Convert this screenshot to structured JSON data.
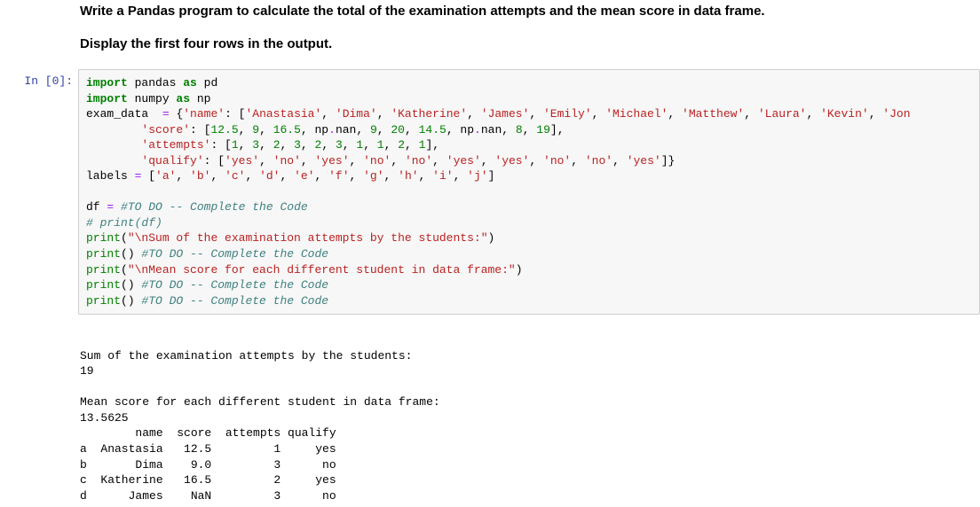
{
  "headings": {
    "h1": "Write a Pandas program to calculate the total of the examination attempts and the mean score in data frame.",
    "h2": "Display the first four rows in the output."
  },
  "prompt": "In [0]:",
  "code": {
    "l1a": "import",
    "l1b": " pandas ",
    "l1c": "as",
    "l1d": " pd",
    "l2a": "import",
    "l2b": " numpy ",
    "l2c": "as",
    "l2d": " np",
    "l3a": "exam_data  ",
    "l3b": "=",
    "l3c": " {",
    "l3d": "'name'",
    "l3e": ": [",
    "l3f": "'Anastasia'",
    "l3g": ", ",
    "l3h": "'Dima'",
    "l3i": ", ",
    "l3j": "'Katherine'",
    "l3k": ", ",
    "l3l": "'James'",
    "l3m": ", ",
    "l3n": "'Emily'",
    "l3o": ", ",
    "l3p": "'Michael'",
    "l3q": ", ",
    "l3r": "'Matthew'",
    "l3s": ", ",
    "l3t": "'Laura'",
    "l3u": ", ",
    "l3v": "'Kevin'",
    "l3w": ", ",
    "l3x": "'Jon",
    "l4a": "        ",
    "l4b": "'score'",
    "l4c": ": [",
    "l4d": "12.5",
    "l4e": ", ",
    "l4f": "9",
    "l4g": ", ",
    "l4h": "16.5",
    "l4i": ", np",
    "l4j": ".",
    "l4k": "nan, ",
    "l4l": "9",
    "l4m": ", ",
    "l4n": "20",
    "l4o": ", ",
    "l4p": "14.5",
    "l4q": ", np",
    "l4r": ".",
    "l4s": "nan, ",
    "l4t": "8",
    "l4u": ", ",
    "l4v": "19",
    "l4w": "],",
    "l5a": "        ",
    "l5b": "'attempts'",
    "l5c": ": [",
    "l5d": "1",
    "l5e": ", ",
    "l5f": "3",
    "l5g": ", ",
    "l5h": "2",
    "l5i": ", ",
    "l5j": "3",
    "l5k": ", ",
    "l5l": "2",
    "l5m": ", ",
    "l5n": "3",
    "l5o": ", ",
    "l5p": "1",
    "l5q": ", ",
    "l5r": "1",
    "l5s": ", ",
    "l5t": "2",
    "l5u": ", ",
    "l5v": "1",
    "l5w": "],",
    "l6a": "        ",
    "l6b": "'qualify'",
    "l6c": ": [",
    "l6d": "'yes'",
    "l6e": ", ",
    "l6f": "'no'",
    "l6g": ", ",
    "l6h": "'yes'",
    "l6i": ", ",
    "l6j": "'no'",
    "l6k": ", ",
    "l6l": "'no'",
    "l6m": ", ",
    "l6n": "'yes'",
    "l6o": ", ",
    "l6p": "'yes'",
    "l6q": ", ",
    "l6r": "'no'",
    "l6s": ", ",
    "l6t": "'no'",
    "l6u": ", ",
    "l6v": "'yes'",
    "l6w": "]}",
    "l7a": "labels ",
    "l7b": "=",
    "l7c": " [",
    "l7d": "'a'",
    "l7e": ", ",
    "l7f": "'b'",
    "l7g": ", ",
    "l7h": "'c'",
    "l7i": ", ",
    "l7j": "'d'",
    "l7k": ", ",
    "l7l": "'e'",
    "l7m": ", ",
    "l7n": "'f'",
    "l7o": ", ",
    "l7p": "'g'",
    "l7q": ", ",
    "l7r": "'h'",
    "l7s": ", ",
    "l7t": "'i'",
    "l7u": ", ",
    "l7v": "'j'",
    "l7w": "]",
    "blank": "",
    "l9a": "df ",
    "l9b": "=",
    "l9c": " ",
    "l9d": "#TO DO -- Complete the Code",
    "l10a": "# print(df)",
    "l11a": "print",
    "l11b": "(",
    "l11c": "\"\\nSum of the examination attempts by the students:\"",
    "l11d": ")",
    "l12a": "print",
    "l12b": "() ",
    "l12c": "#TO DO -- Complete the Code",
    "l13a": "print",
    "l13b": "(",
    "l13c": "\"\\nMean score for each different student in data frame:\"",
    "l13d": ")",
    "l14a": "print",
    "l14b": "() ",
    "l14c": "#TO DO -- Complete the Code",
    "l15a": "print",
    "l15b": "() ",
    "l15c": "#TO DO -- Complete the Code"
  },
  "output": "\nSum of the examination attempts by the students:\n19\n\nMean score for each different student in data frame:\n13.5625\n        name  score  attempts qualify\na  Anastasia   12.5         1     yes\nb       Dima    9.0         3      no\nc  Katherine   16.5         2     yes\nd      James    NaN         3      no"
}
